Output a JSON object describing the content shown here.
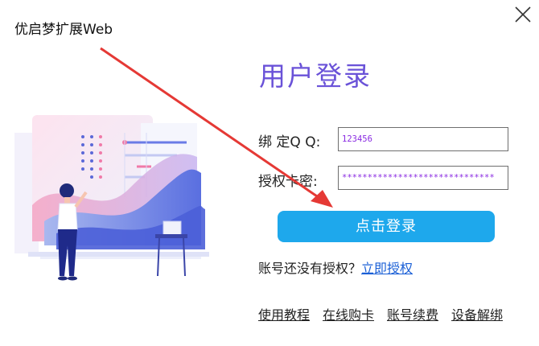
{
  "window": {
    "title": "优启梦扩展Web",
    "close_icon": "close-icon"
  },
  "login": {
    "heading": "用户登录",
    "qq_label": "绑 定Q Q:",
    "qq_value": "123456",
    "key_label": "授权卡密:",
    "key_value": "******************************",
    "submit_label": "点击登录",
    "no_auth_text": "账号还没有授权？",
    "authorize_link": "立即授权"
  },
  "footer_links": [
    "使用教程",
    "在线购卡",
    "账号续费",
    "设备解绑"
  ],
  "colors": {
    "heading": "#6a52d8",
    "button": "#1ea8ec",
    "input_text": "#8a2be2",
    "link": "#1a5fd6",
    "annotation_arrow": "#e53935"
  },
  "annotation": {
    "type": "arrow",
    "color": "red",
    "points_to": "login-button"
  }
}
